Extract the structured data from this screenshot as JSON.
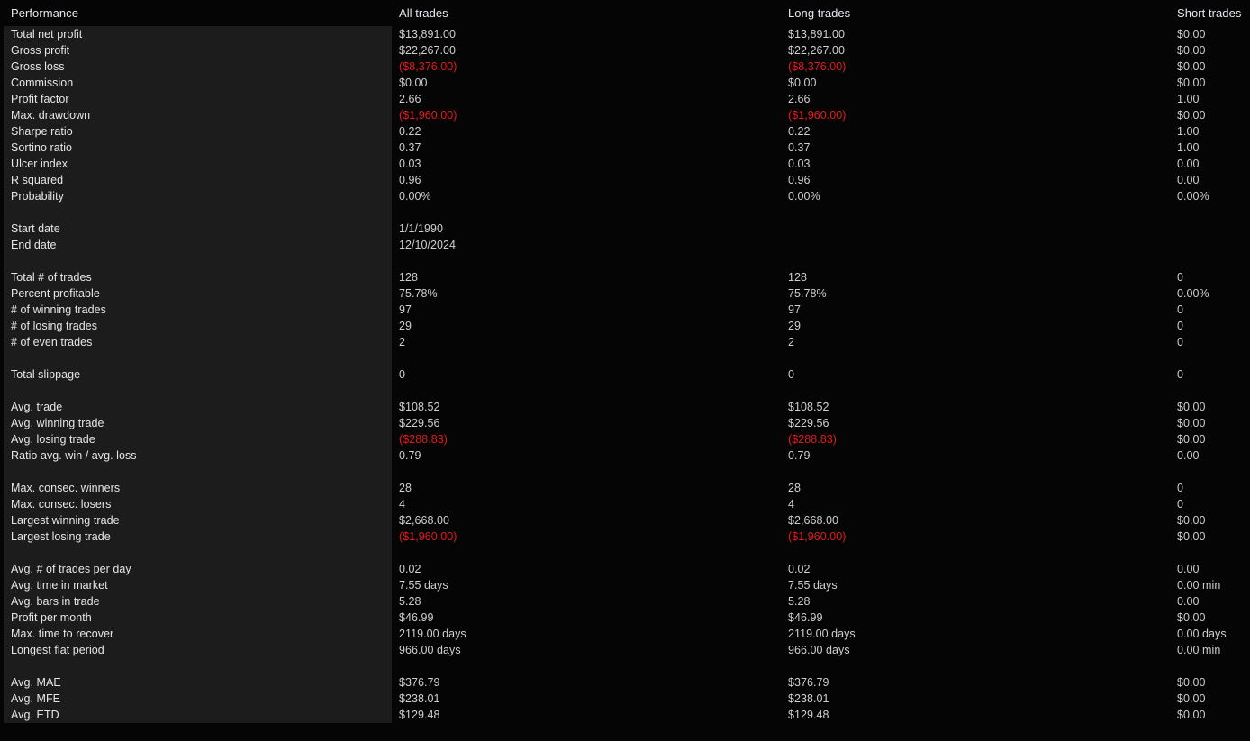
{
  "colors": {
    "background": "#050505",
    "panel": "#1c1c1c",
    "header_text": "#e8e8ef",
    "label_text": "#e6e6e6",
    "value_text": "#cfcfcf",
    "negative_text": "#e31b1b"
  },
  "header": {
    "performance": "Performance",
    "all_trades": "All trades",
    "long_trades": "Long trades",
    "short_trades": "Short trades"
  },
  "rows": [
    {
      "label": "Total net profit",
      "all": "$13,891.00",
      "long": "$13,891.00",
      "short": "$0.00"
    },
    {
      "label": "Gross profit",
      "all": "$22,267.00",
      "long": "$22,267.00",
      "short": "$0.00"
    },
    {
      "label": "Gross loss",
      "all": "($8,376.00)",
      "long": "($8,376.00)",
      "short": "$0.00",
      "all_neg": true,
      "long_neg": true
    },
    {
      "label": "Commission",
      "all": "$0.00",
      "long": "$0.00",
      "short": "$0.00"
    },
    {
      "label": "Profit factor",
      "all": "2.66",
      "long": "2.66",
      "short": "1.00"
    },
    {
      "label": "Max. drawdown",
      "all": "($1,960.00)",
      "long": "($1,960.00)",
      "short": "$0.00",
      "all_neg": true,
      "long_neg": true
    },
    {
      "label": "Sharpe ratio",
      "all": "0.22",
      "long": "0.22",
      "short": "1.00"
    },
    {
      "label": "Sortino ratio",
      "all": "0.37",
      "long": "0.37",
      "short": "1.00"
    },
    {
      "label": "Ulcer index",
      "all": "0.03",
      "long": "0.03",
      "short": "0.00"
    },
    {
      "label": "R squared",
      "all": "0.96",
      "long": "0.96",
      "short": "0.00"
    },
    {
      "label": "Probability",
      "all": "0.00%",
      "long": "0.00%",
      "short": "0.00%"
    },
    {
      "spacer": true
    },
    {
      "label": "Start date",
      "all": "1/1/1990",
      "long": "",
      "short": ""
    },
    {
      "label": "End date",
      "all": "12/10/2024",
      "long": "",
      "short": ""
    },
    {
      "spacer": true
    },
    {
      "label": "Total # of trades",
      "all": "128",
      "long": "128",
      "short": "0"
    },
    {
      "label": "Percent profitable",
      "all": "75.78%",
      "long": "75.78%",
      "short": "0.00%"
    },
    {
      "label": "# of winning trades",
      "all": "97",
      "long": "97",
      "short": "0"
    },
    {
      "label": "# of losing trades",
      "all": "29",
      "long": "29",
      "short": "0"
    },
    {
      "label": "# of even trades",
      "all": "2",
      "long": "2",
      "short": "0"
    },
    {
      "spacer": true
    },
    {
      "label": "Total slippage",
      "all": "0",
      "long": "0",
      "short": "0"
    },
    {
      "spacer": true
    },
    {
      "label": "Avg. trade",
      "all": "$108.52",
      "long": "$108.52",
      "short": "$0.00"
    },
    {
      "label": "Avg. winning trade",
      "all": "$229.56",
      "long": "$229.56",
      "short": "$0.00"
    },
    {
      "label": "Avg. losing trade",
      "all": "($288.83)",
      "long": "($288.83)",
      "short": "$0.00",
      "all_neg": true,
      "long_neg": true
    },
    {
      "label": "Ratio avg. win / avg. loss",
      "all": "0.79",
      "long": "0.79",
      "short": "0.00"
    },
    {
      "spacer": true
    },
    {
      "label": "Max. consec. winners",
      "all": "28",
      "long": "28",
      "short": "0"
    },
    {
      "label": "Max. consec. losers",
      "all": "4",
      "long": "4",
      "short": "0"
    },
    {
      "label": "Largest winning trade",
      "all": "$2,668.00",
      "long": "$2,668.00",
      "short": "$0.00"
    },
    {
      "label": "Largest losing trade",
      "all": "($1,960.00)",
      "long": "($1,960.00)",
      "short": "$0.00",
      "all_neg": true,
      "long_neg": true
    },
    {
      "spacer": true
    },
    {
      "label": "Avg. # of trades per day",
      "all": "0.02",
      "long": "0.02",
      "short": "0.00"
    },
    {
      "label": "Avg. time in market",
      "all": "7.55 days",
      "long": "7.55 days",
      "short": "0.00 min"
    },
    {
      "label": "Avg. bars in trade",
      "all": "5.28",
      "long": "5.28",
      "short": "0.00"
    },
    {
      "label": "Profit per month",
      "all": "$46.99",
      "long": "$46.99",
      "short": "$0.00"
    },
    {
      "label": "Max. time to recover",
      "all": "2119.00 days",
      "long": "2119.00 days",
      "short": "0.00 days"
    },
    {
      "label": "Longest flat period",
      "all": "966.00 days",
      "long": "966.00 days",
      "short": "0.00 min"
    },
    {
      "spacer": true
    },
    {
      "label": "Avg. MAE",
      "all": "$376.79",
      "long": "$376.79",
      "short": "$0.00"
    },
    {
      "label": "Avg. MFE",
      "all": "$238.01",
      "long": "$238.01",
      "short": "$0.00"
    },
    {
      "label": "Avg. ETD",
      "all": "$129.48",
      "long": "$129.48",
      "short": "$0.00"
    }
  ]
}
